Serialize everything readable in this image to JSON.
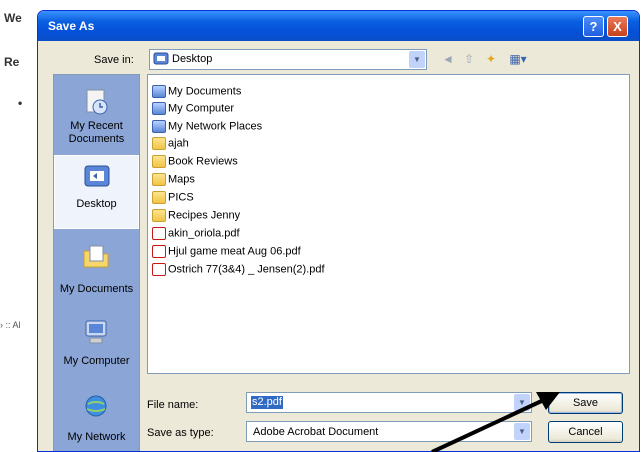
{
  "background": {
    "line1": "We",
    "line2": "Re",
    "bullet": "•",
    "side_left": "› :: Al",
    "side_right": "("
  },
  "dialog": {
    "title": "Save As",
    "help_label": "?",
    "close_label": "X"
  },
  "save_in": {
    "label": "Save in:",
    "value": "Desktop",
    "arrow": "▼"
  },
  "toolbar": {
    "back": "◄",
    "up": "⇧",
    "new_folder": "✦",
    "views": "▦▾"
  },
  "places": [
    {
      "label": "My Recent Documents",
      "icon": "recent-documents-icon"
    },
    {
      "label": "Desktop",
      "icon": "desktop-icon"
    },
    {
      "label": "My Documents",
      "icon": "my-documents-icon"
    },
    {
      "label": "My Computer",
      "icon": "my-computer-icon"
    },
    {
      "label": "My Network",
      "icon": "network-icon"
    }
  ],
  "files": [
    {
      "name": "My Documents",
      "type": "sys"
    },
    {
      "name": "My Computer",
      "type": "sys"
    },
    {
      "name": "My Network Places",
      "type": "sys"
    },
    {
      "name": "ajah",
      "type": "folder"
    },
    {
      "name": "Book Reviews",
      "type": "folder"
    },
    {
      "name": "Maps",
      "type": "folder"
    },
    {
      "name": "PICS",
      "type": "folder"
    },
    {
      "name": "Recipes Jenny",
      "type": "folder"
    },
    {
      "name": "akin_oriola.pdf",
      "type": "pdf"
    },
    {
      "name": "Hjul game meat Aug 06.pdf",
      "type": "pdf"
    },
    {
      "name": "Ostrich 77(3&4) _ Jensen(2).pdf",
      "type": "pdf"
    }
  ],
  "file_name": {
    "label": "File name:",
    "value": "s2.pdf"
  },
  "save_as_type": {
    "label": "Save as type:",
    "value": "Adobe Acrobat Document"
  },
  "buttons": {
    "save": "Save",
    "cancel": "Cancel"
  },
  "colors": {
    "titlebar": "#0a5fe0",
    "dialog_bg": "#ece9d8",
    "places_bar": "#8aa5d6",
    "selection": "#316ac5"
  }
}
